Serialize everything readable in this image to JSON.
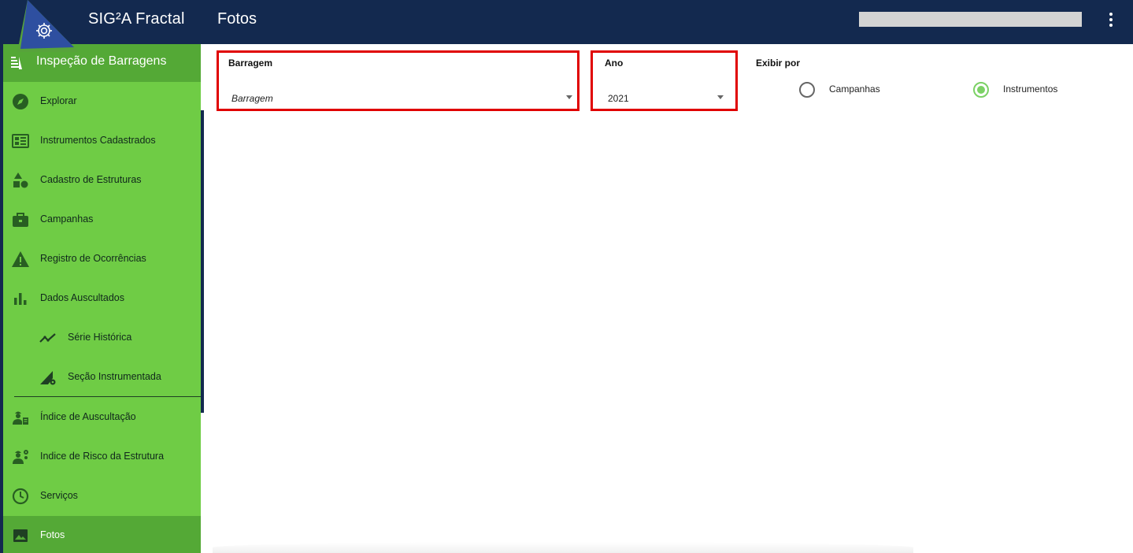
{
  "header": {
    "app_title": "SIG²A Fractal",
    "page_title": "Fotos",
    "user_name": "",
    "colors": {
      "topbar": "#13294f",
      "logo": "#2e4fa0"
    }
  },
  "sidebar": {
    "title": "Inspeção de Barragens",
    "colors": {
      "background": "#6fcc45",
      "active": "#54a936"
    },
    "items": [
      {
        "label": "Explorar",
        "icon": "compass-icon"
      },
      {
        "label": "Instrumentos Cadastrados",
        "icon": "dashboard-icon"
      },
      {
        "label": "Cadastro de Estruturas",
        "icon": "shapes-icon"
      },
      {
        "label": "Campanhas",
        "icon": "briefcase-icon"
      },
      {
        "label": "Registro de Ocorrências",
        "icon": "warning-icon"
      },
      {
        "label": "Dados Auscultados",
        "icon": "bar-chart-icon"
      },
      {
        "label": "Série Histórica",
        "icon": "trend-line-icon"
      },
      {
        "label": "Seção Instrumentada",
        "icon": "section-settings-icon"
      },
      {
        "label": "Índice de Auscultação",
        "icon": "engineer-report-icon"
      },
      {
        "label": "Indice de Risco da Estrutura",
        "icon": "engineer-settings-icon"
      },
      {
        "label": "Serviços",
        "icon": "clock-icon"
      },
      {
        "label": "Fotos",
        "icon": "image-icon",
        "active": true
      }
    ]
  },
  "filters": {
    "barragem": {
      "label": "Barragem",
      "placeholder": "Barragem"
    },
    "ano": {
      "label": "Ano",
      "value": "2021"
    },
    "exibir": {
      "label": "Exibir por",
      "options": [
        {
          "label": "Campanhas",
          "checked": false
        },
        {
          "label": "Instrumentos",
          "checked": true
        }
      ]
    }
  }
}
